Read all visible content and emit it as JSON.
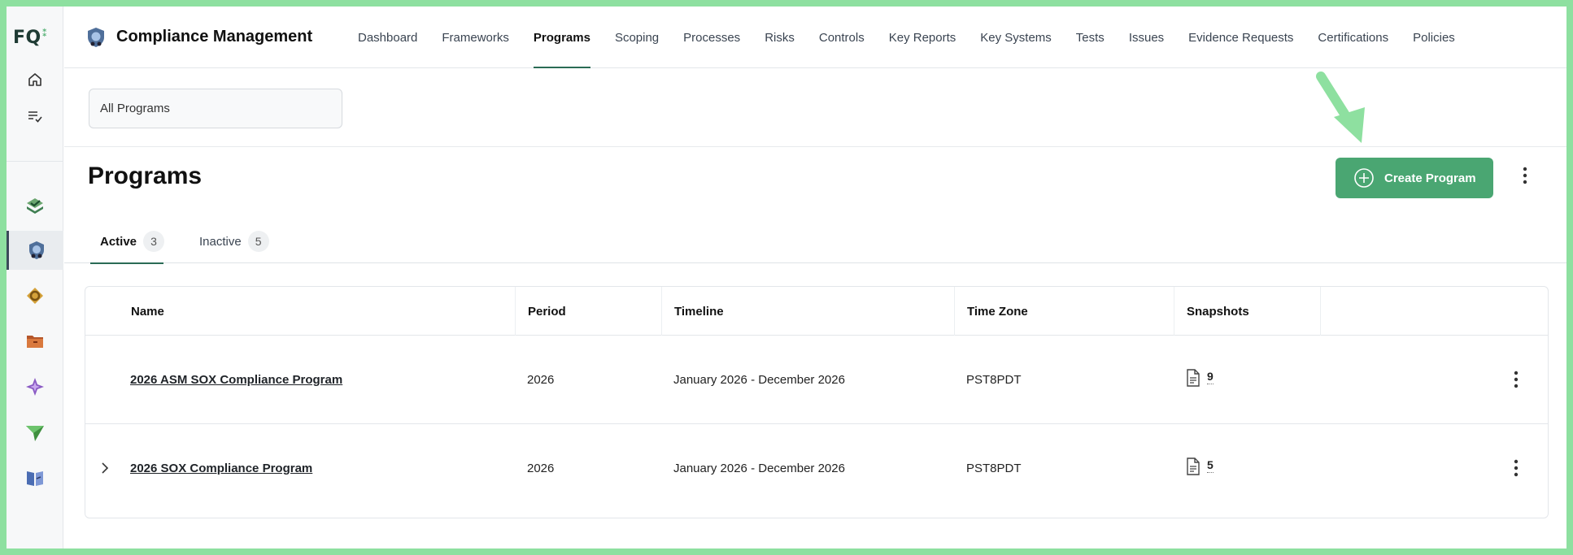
{
  "app": {
    "logo_text": "FQ",
    "title": "Compliance Management"
  },
  "nav": {
    "items": [
      {
        "label": "Dashboard",
        "active": false
      },
      {
        "label": "Frameworks",
        "active": false
      },
      {
        "label": "Programs",
        "active": true
      },
      {
        "label": "Scoping",
        "active": false
      },
      {
        "label": "Processes",
        "active": false
      },
      {
        "label": "Risks",
        "active": false
      },
      {
        "label": "Controls",
        "active": false
      },
      {
        "label": "Key Reports",
        "active": false
      },
      {
        "label": "Key Systems",
        "active": false
      },
      {
        "label": "Tests",
        "active": false
      },
      {
        "label": "Issues",
        "active": false
      },
      {
        "label": "Evidence Requests",
        "active": false
      },
      {
        "label": "Certifications",
        "active": false
      },
      {
        "label": "Policies",
        "active": false
      }
    ]
  },
  "rail": {
    "icons": [
      "home-icon",
      "task-list-icon",
      "check-stack-icon",
      "compliance-shield-icon",
      "link-icon",
      "folder-icon",
      "sparkle-icon",
      "send-icon",
      "book-icon"
    ],
    "active": "compliance-shield-icon"
  },
  "selector": {
    "value": "All Programs"
  },
  "page": {
    "title": "Programs",
    "create_label": "Create Program"
  },
  "tabs": [
    {
      "label": "Active",
      "count": "3",
      "active": true
    },
    {
      "label": "Inactive",
      "count": "5",
      "active": false
    }
  ],
  "table": {
    "headers": {
      "name": "Name",
      "period": "Period",
      "timeline": "Timeline",
      "timezone": "Time Zone",
      "snapshots": "Snapshots"
    },
    "rows": [
      {
        "name": "2026 ASM SOX Compliance Program",
        "period": "2026",
        "timeline": "January 2026 - December 2026",
        "timezone": "PST8PDT",
        "snapshots": "9",
        "expandable": false
      },
      {
        "name": "2026 SOX Compliance Program",
        "period": "2026",
        "timeline": "January 2026 - December 2026",
        "timezone": "PST8PDT",
        "snapshots": "5",
        "expandable": true
      }
    ]
  },
  "colors": {
    "accent": "#4aa672",
    "active_underline": "#2a6b55",
    "frame": "#8ee0a0"
  }
}
